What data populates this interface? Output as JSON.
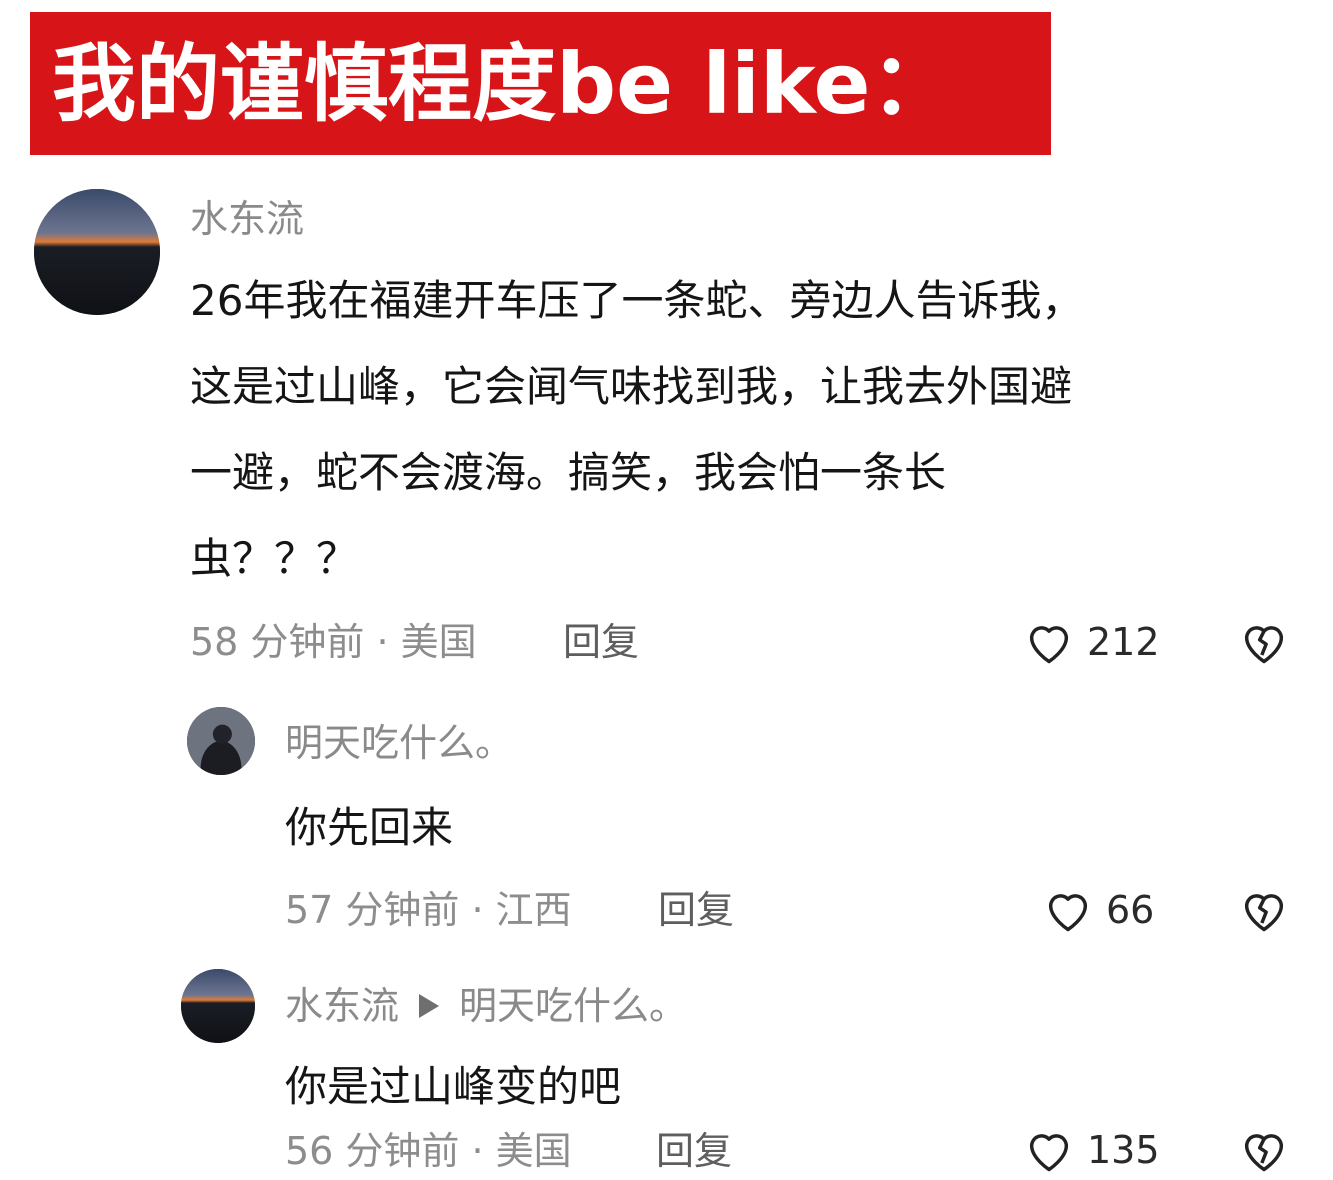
{
  "banner": {
    "title": "我的谨慎程度be  like："
  },
  "comments": [
    {
      "user": "水东流",
      "lines": [
        "26年我在福建开车压了一条蛇、旁边人告诉我，",
        "这是过山峰，它会闻气味找到我，让我去外国避",
        "一避，蛇不会渡海。搞笑，我会怕一条长",
        "虫？？？"
      ],
      "time": "58 分钟前 · 美国",
      "reply_label": "回复",
      "likes": "212",
      "like_icon": "heart-outline-icon",
      "dislike_icon": "broken-heart-icon"
    },
    {
      "user": "明天吃什么。",
      "text": "你先回来",
      "time": "57 分钟前 · 江西",
      "reply_label": "回复",
      "likes": "66"
    },
    {
      "user": "水东流",
      "reply_to": "明天吃什么。",
      "text": "你是过山峰变的吧",
      "time": "56 分钟前 · 美国",
      "reply_label": "回复",
      "likes": "135"
    }
  ],
  "colors": {
    "banner": "#d71418",
    "meta": "#8d8d8d"
  }
}
